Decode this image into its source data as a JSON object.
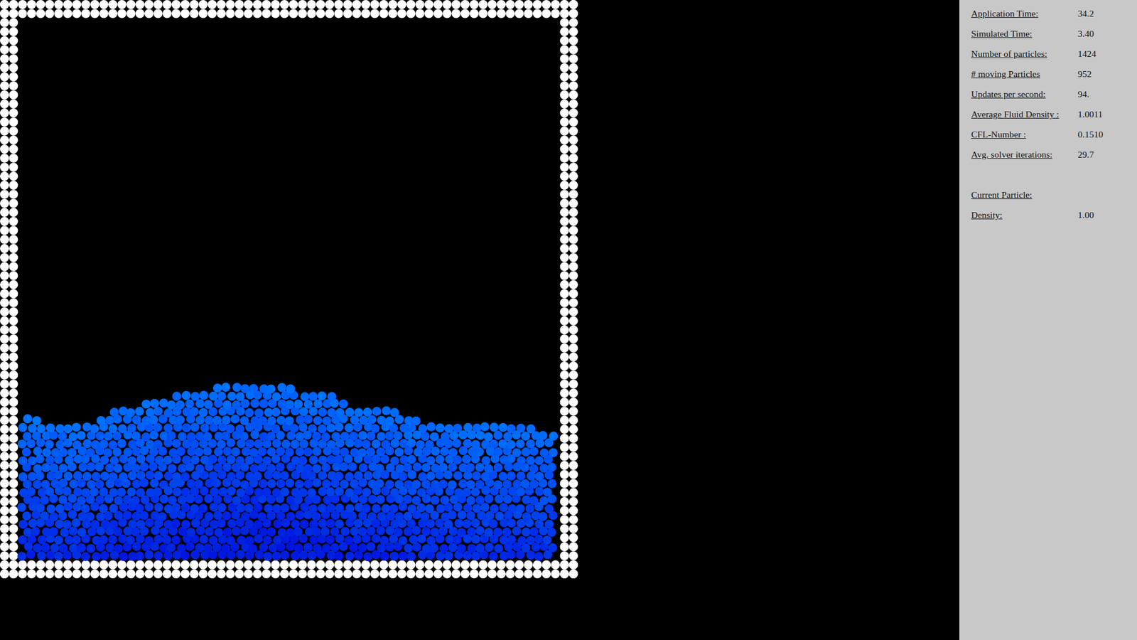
{
  "stats": [
    {
      "label": "Application Time:",
      "value": "34.2"
    },
    {
      "label": "Simulated Time:",
      "value": "3.40"
    },
    {
      "label": "Number of particles:",
      "value": "1424"
    },
    {
      "label": "# moving Particles",
      "value": "952"
    },
    {
      "label": "Updates per second:",
      "value": "94."
    },
    {
      "label": "Average Fluid Density :",
      "value": "1.0011"
    },
    {
      "label": "CFL-Number :",
      "value": "0.1510"
    },
    {
      "label": "Avg. solver iterations:",
      "value": "29.7"
    }
  ],
  "current_particle": {
    "label": "Current Particle:",
    "fields": [
      {
        "label": "Density:",
        "value": "1.00"
      }
    ]
  }
}
